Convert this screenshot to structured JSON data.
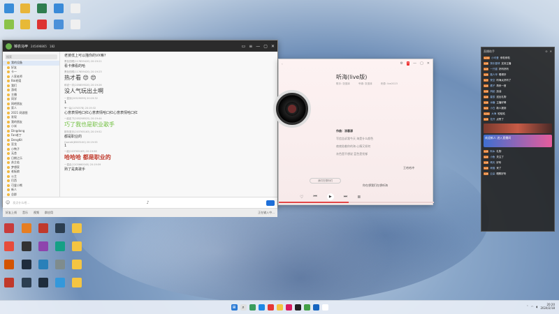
{
  "desktop": {
    "icons": [
      {
        "label": "",
        "color": "#3b8dd8",
        "glyph": "⬛"
      },
      {
        "label": "",
        "color": "#e8b53a",
        "glyph": "⬛"
      },
      {
        "label": "",
        "color": "#2f7d4f",
        "glyph": "⬛"
      },
      {
        "label": "",
        "color": "#3a8ad8",
        "glyph": "⬛"
      },
      {
        "label": "",
        "color": "#e8e8e8",
        "glyph": "⬛"
      },
      {
        "label": "",
        "color": "#8bc34a",
        "glyph": "⬛"
      },
      {
        "label": "",
        "color": "#e7b936",
        "glyph": "⬛"
      },
      {
        "label": "",
        "color": "#d33",
        "glyph": "⬛"
      },
      {
        "label": "",
        "color": "#4a90d9",
        "glyph": "⬛"
      },
      {
        "label": "",
        "color": "#e8e8e8",
        "glyph": "⬛"
      }
    ]
  },
  "qq": {
    "title": "锦衣马甲",
    "num": "245496865",
    "friends_count": "182",
    "search_placeholder": "搜索",
    "contacts": [
      "我的设备",
      "好友",
      "卡一",
      "人家老师",
      "Bai老姐",
      "我们",
      "游戏",
      "主播",
      "同学",
      "网吧朋友",
      "家人",
      "2021 网游图",
      "发现",
      "我的朋友",
      "小米",
      "Dingdong",
      "Fan老丁",
      "DengKit",
      "亚龙",
      "小鸭子",
      "无恙",
      "日期之乐",
      "苏芷若",
      "梦想家",
      "老板娘",
      "公主",
      "巴西",
      "可爱小熊",
      "新人",
      "总群"
    ],
    "chat_header": "老婆低上可以描你的VX嘛?",
    "messages": [
      {
        "meta": "黑色的眼(117659420)  20:19:21",
        "text": "看卡佛看的哈",
        "style": ""
      },
      {
        "meta": "黑色的眼(117659420)  20:19:23",
        "text": "热才看 😍 😍",
        "style": "big"
      },
      {
        "meta": "和说一次(205859520)  20:19:26",
        "text": "没人气玩出土啊",
        "style": "big"
      },
      {
        "meta": "一直到(20529099)  20:19:32",
        "text": "1",
        "style": ""
      },
      {
        "meta": "♥一朵(1474578)  20:19:32",
        "text": "心意表情哈口红心意表情哈口红心意表情哈口红",
        "style": ""
      },
      {
        "meta": "一起走下(205298525)  20:19:44",
        "text": "巧了我也是职业歌手",
        "style": "green"
      },
      {
        "meta": "那年夏天(203765163)  20:19:52",
        "text": "都是职业的",
        "style": ""
      },
      {
        "meta": "Garrett(8563100)  20:19:55",
        "text": "1",
        "style": ""
      },
      {
        "meta": "一起(203765163)  20:19:58",
        "text": "哈哈哈 都是职业的",
        "style": "red"
      },
      {
        "meta": "一直走(1203660045)  20:19:59",
        "text": "熟了是真歌手",
        "style": ""
      }
    ],
    "input_placeholder": "发点什么吧...",
    "bottom_items": [
      "好友上线",
      "音乐",
      "视频",
      "群应用"
    ],
    "status": "正在输入中..."
  },
  "music": {
    "song_title": "听海(live版)",
    "meta_singer": "歌手: 张惠妹",
    "meta_album": "专辑: 张惠妹",
    "meta_source": "来源: live2023",
    "lyrics": [
      {
        "text": "作曲：涂惠源",
        "current": true
      },
      {
        "text": "写信告诉我今天 海是什么颜色",
        "current": false
      },
      {
        "text": "夜夜陪着你的海 心情又如何",
        "current": false
      },
      {
        "text": "灰色是不想说 蓝色是忧郁",
        "current": false
      }
    ],
    "comment_label": "我们在想你们",
    "now_playing": "你在想我们在想听海",
    "user": "王哈哈冲",
    "progress": 0.45
  },
  "live": {
    "header": "直播助手",
    "rows": [
      {
        "badge": "Lv12",
        "nick": "小可爱",
        "text": "来啦来啦"
      },
      {
        "badge": "Lv8",
        "nick": "快乐星球",
        "text": "支持主播"
      },
      {
        "badge": "Lv3",
        "nick": "一只猫",
        "text": "好听好听"
      },
      {
        "badge": "Lv5",
        "nick": "路人甲",
        "text": "唱得好"
      },
      {
        "badge": "Lv7",
        "nick": "夜空",
        "text": "听海太好听了"
      },
      {
        "badge": "Lv2",
        "nick": "橘子",
        "text": "再来一首"
      },
      {
        "badge": "Lv9",
        "nick": "风起",
        "text": "加油"
      },
      {
        "badge": "Lv4",
        "nick": "星辰",
        "text": "送出礼物"
      },
      {
        "badge": "Lv6",
        "nick": "冰糖",
        "text": "主播好棒"
      },
      {
        "badge": "Lv1",
        "nick": "小白",
        "text": "新人报到"
      },
      {
        "badge": "Lv11",
        "nick": "大海",
        "text": "哈哈哈"
      },
      {
        "badge": "Lv3",
        "nick": "花开",
        "text": "点赞了"
      }
    ],
    "gift_text": "欢迎新人 进入直播间",
    "rows2": [
      {
        "badge": "Lv5",
        "nick": "阿木",
        "text": "礼物"
      },
      {
        "badge": "Lv2",
        "nick": "小鱼",
        "text": "关注了"
      },
      {
        "badge": "Lv8",
        "nick": "晴天",
        "text": "好听"
      },
      {
        "badge": "Lv4",
        "nick": "雨落",
        "text": "来了"
      },
      {
        "badge": "Lv6",
        "nick": "云朵",
        "text": "唱歌好听"
      }
    ]
  },
  "taskbar": {
    "time": "20:20",
    "date": "2024/2/18"
  }
}
